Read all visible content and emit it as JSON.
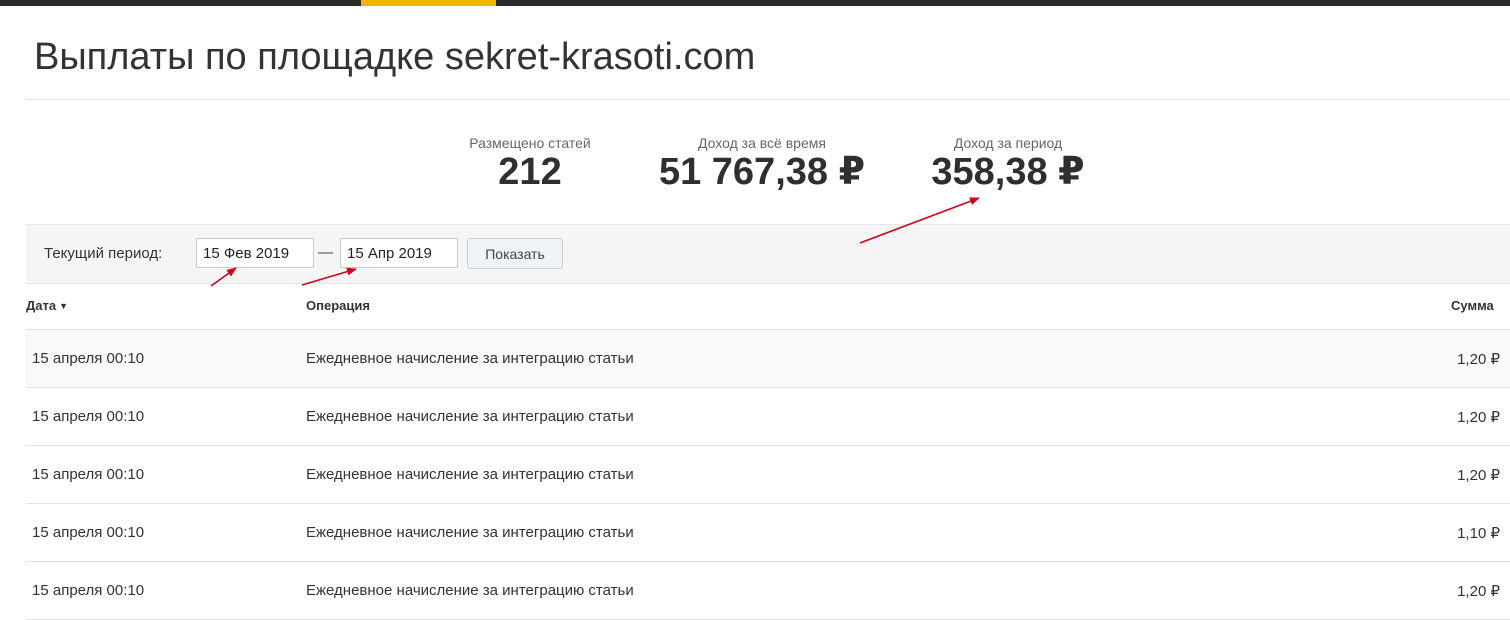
{
  "page": {
    "title": "Выплаты по площадке sekret-krasoti.com"
  },
  "stats": [
    {
      "label": "Размещено статей",
      "value": "212"
    },
    {
      "label": "Доход за всё время",
      "value": "51 767,38 ₽"
    },
    {
      "label": "Доход за период",
      "value": "358,38 ₽"
    }
  ],
  "filter": {
    "label": "Текущий период:",
    "date_from": "15 Фев 2019",
    "separator": "—",
    "date_to": "15 Апр 2019",
    "show_label": "Показать"
  },
  "table": {
    "columns": {
      "date": "Дата",
      "operation": "Операция",
      "amount": "Сумма"
    },
    "rows": [
      {
        "date": "15 апреля 00:10",
        "operation": "Ежедневное начисление за интеграцию статьи",
        "amount": "1,20 ₽"
      },
      {
        "date": "15 апреля 00:10",
        "operation": "Ежедневное начисление за интеграцию статьи",
        "amount": "1,20 ₽"
      },
      {
        "date": "15 апреля 00:10",
        "operation": "Ежедневное начисление за интеграцию статьи",
        "amount": "1,20 ₽"
      },
      {
        "date": "15 апреля 00:10",
        "operation": "Ежедневное начисление за интеграцию статьи",
        "amount": "1,10 ₽"
      },
      {
        "date": "15 апреля 00:10",
        "operation": "Ежедневное начисление за интеграцию статьи",
        "amount": "1,20 ₽"
      }
    ]
  },
  "colors": {
    "accent": "#f5b400",
    "topbar": "#2b2b2b",
    "annotation_arrow": "#d0021b"
  },
  "icons": {
    "sort": "caret-down-icon"
  }
}
